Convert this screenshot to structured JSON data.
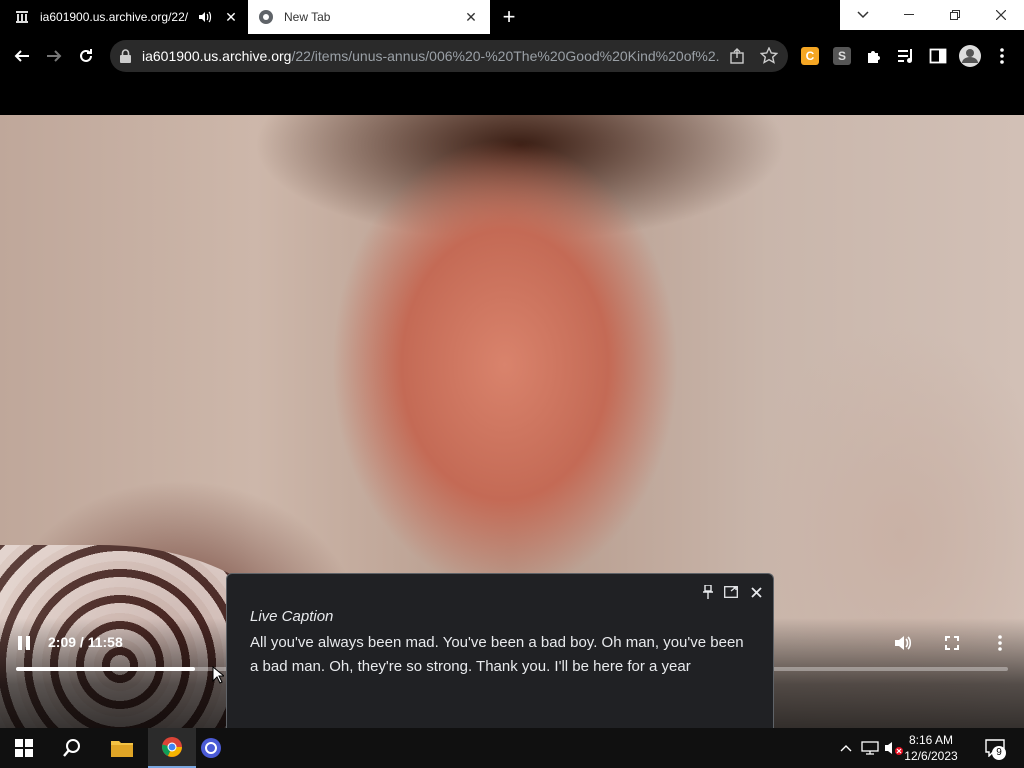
{
  "browser": {
    "tabs": [
      {
        "title": "ia601900.us.archive.org/22/",
        "active": true
      },
      {
        "title": "New Tab",
        "active": false
      }
    ],
    "url_host": "ia601900.us.archive.org",
    "url_path": "/22/items/unus-annus/006%20-%20The%20Good%20Kind%20of%2..."
  },
  "video": {
    "time_display": "2:09 / 11:58",
    "progress_fraction": 0.18
  },
  "live_caption": {
    "title": "Live Caption",
    "text": "All you've always been mad. You've been a bad boy. Oh man, you've been a bad man. Oh, they're so strong. Thank you. I'll be here for a year"
  },
  "taskbar": {
    "time": "8:16 AM",
    "date": "12/6/2023",
    "notification_count": "9"
  },
  "colors": {
    "chrome_orange": "#f5a623",
    "windows_blue": "#0a84ff"
  }
}
